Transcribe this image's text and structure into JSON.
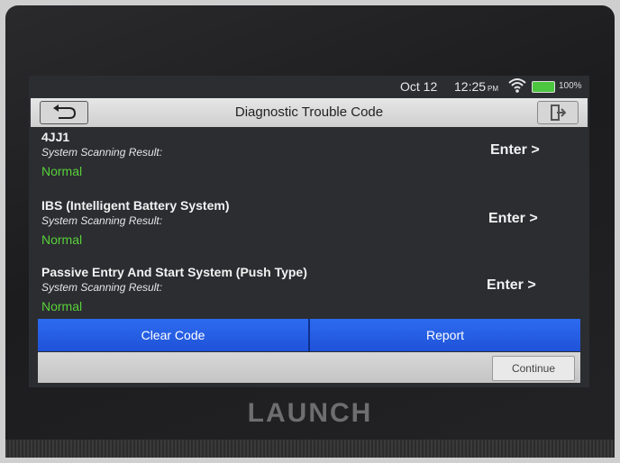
{
  "status_bar": {
    "date": "Oct 12",
    "time": "12:25",
    "ampm": "PM",
    "battery_text": "100%",
    "battery_color": "#4cc53f",
    "icons": [
      "wifi-icon",
      "battery-icon"
    ]
  },
  "title_bar": {
    "title": "Diagnostic Trouble Code",
    "back_icon": "back-arrow-icon",
    "exit_icon": "exit-icon"
  },
  "systems": [
    {
      "name": "4JJ1",
      "label": "System Scanning Result:",
      "result": "Normal",
      "action": "Enter >"
    },
    {
      "name": "IBS (Intelligent Battery System)",
      "label": "System Scanning Result:",
      "result": "Normal",
      "action": "Enter >"
    },
    {
      "name": "Passive Entry And Start System (Push Type)",
      "label": "System Scanning Result:",
      "result": "Normal",
      "action": "Enter >"
    }
  ],
  "buttons": {
    "clear_code": "Clear Code",
    "report": "Report",
    "continue": "Continue"
  },
  "colors": {
    "accent_button": "#2d6bf0",
    "normal_status": "#5ad13a",
    "screen_bg": "#2b2d31"
  },
  "device": {
    "brand": "LAUNCH"
  }
}
